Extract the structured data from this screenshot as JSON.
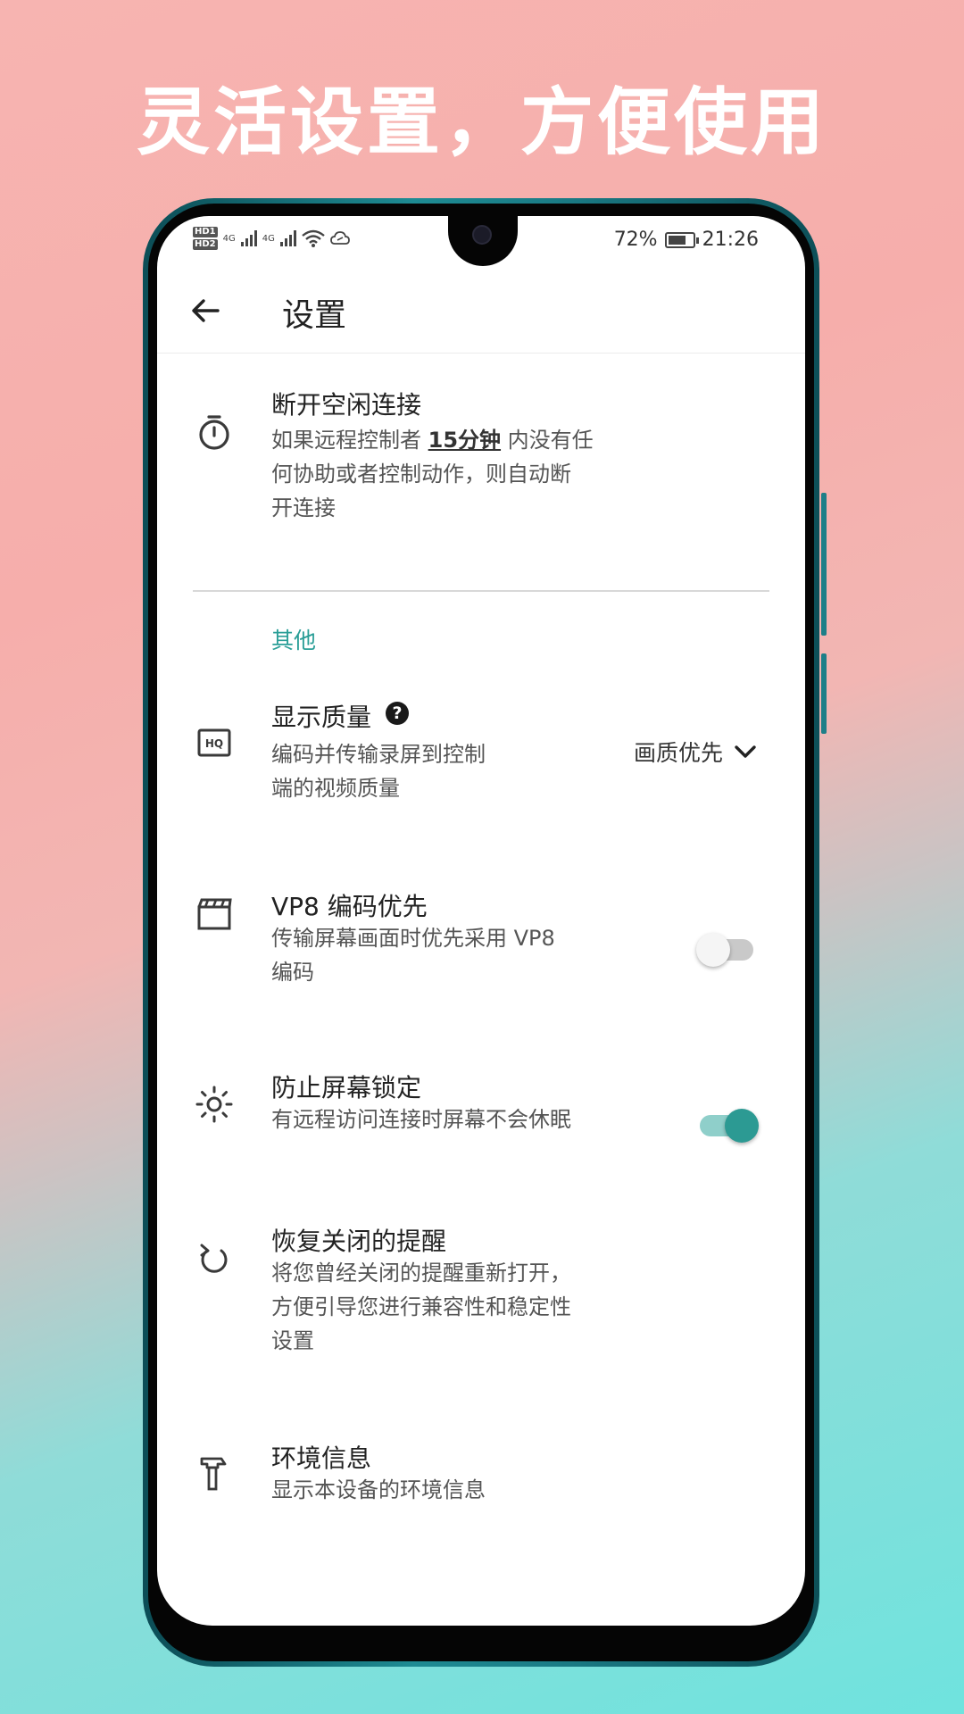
{
  "headline": "灵活设置，方便使用",
  "status_bar": {
    "sim1": "HD1",
    "sim2": "HD2",
    "net1": "4G",
    "net2": "4G",
    "battery_percent": "72%",
    "battery_level": 0.72,
    "time": "21:26"
  },
  "app_bar": {
    "back_icon": "arrow-left-icon",
    "title": "设置"
  },
  "idle": {
    "icon": "stopwatch-icon",
    "title": "断开空闲连接",
    "desc_before": "如果远程控制者 ",
    "desc_highlight": "15分钟",
    "desc_line1_after": " 内没有任",
    "desc_line2": "何协助或者控制动作，则自动断",
    "desc_line3": "开连接"
  },
  "section_other": "其他",
  "quality": {
    "icon": "hq-icon",
    "title": "显示质量",
    "help": "?",
    "desc_line1": "编码并传输录屏到控制",
    "desc_line2": "端的视频质量",
    "dropdown_value": "画质优先"
  },
  "vp8": {
    "icon": "clapperboard-icon",
    "title": "VP8 编码优先",
    "desc_line1": "传输屏幕画面时优先采用 VP8",
    "desc_line2": "编码",
    "enabled": false
  },
  "lock": {
    "icon": "brightness-icon",
    "title": "防止屏幕锁定",
    "desc_line1": "有远程访问连接时屏幕不会休眠",
    "enabled": true
  },
  "restore": {
    "icon": "refresh-icon",
    "title": "恢复关闭的提醒",
    "desc_line1": "将您曾经关闭的提醒重新打开，",
    "desc_line2": "方便引导您进行兼容性和稳定性",
    "desc_line3": "设置"
  },
  "env": {
    "icon": "hammer-icon",
    "title": "环境信息",
    "desc_line1": "显示本设备的环境信息"
  },
  "colors": {
    "accent": "#2a9e97",
    "frame": "#1b7d87"
  }
}
